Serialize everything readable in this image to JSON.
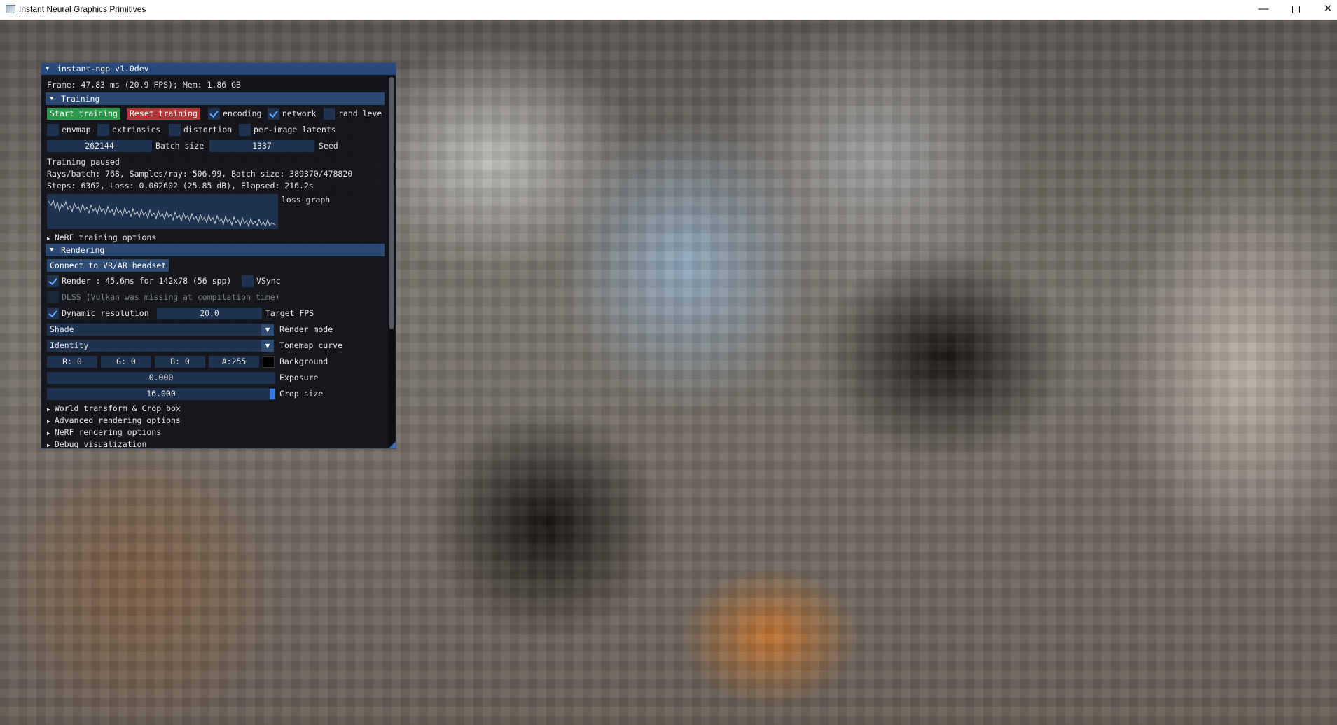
{
  "window": {
    "title": "Instant Neural Graphics Primitives",
    "minimize": "—",
    "close": "✕"
  },
  "panel": {
    "title": "instant-ngp v1.0dev",
    "frame_info": "Frame: 47.83 ms (20.9 FPS); Mem: 1.86 GB",
    "training": {
      "header": "Training",
      "start_label": "Start training",
      "reset_label": "Reset training",
      "encoding_label": "encoding",
      "network_label": "network",
      "rand_levels_label": "rand leve",
      "envmap_label": "envmap",
      "extrinsics_label": "extrinsics",
      "distortion_label": "distortion",
      "latents_label": "per-image latents",
      "batch_size_value": "262144",
      "batch_size_label": "Batch size",
      "seed_value": "1337",
      "seed_label": "Seed",
      "status": "Training paused",
      "rays_line": "Rays/batch: 768, Samples/ray: 506.99, Batch size: 389370/478820",
      "steps_line": "Steps: 6362, Loss: 0.002602 (25.85 dB), Elapsed: 216.2s",
      "loss_graph_label": "loss graph",
      "nerf_options": "NeRF training options"
    },
    "rendering": {
      "header": "Rendering",
      "vr_label": "Connect to VR/AR headset",
      "render_label": "Render : 45.6ms for 142x78 (56 spp)",
      "vsync_label": "VSync",
      "dlss_label": "DLSS (Vulkan was missing at compilation time)",
      "dynres_label": "Dynamic resolution",
      "target_fps_value": "20.0",
      "target_fps_label": "Target FPS",
      "render_mode_value": "Shade",
      "render_mode_label": "Render mode",
      "tonemap_value": "Identity",
      "tonemap_label": "Tonemap curve",
      "bg_r": "R:  0",
      "bg_g": "G:  0",
      "bg_b": "B:  0",
      "bg_a": "A:255",
      "background_label": "Background",
      "exposure_value": "0.000",
      "exposure_label": "Exposure",
      "crop_value": "16.000",
      "crop_label": "Crop size",
      "world_transform": "World transform & Crop box",
      "advanced": "Advanced rendering options",
      "nerf_render": "NeRF rendering options",
      "debug": "Debug visualization"
    }
  },
  "colors": {
    "title_bar": "#29497a",
    "header": "#2a4870",
    "start_button": "#2a9a4a",
    "reset_button": "#b03838",
    "checkmark": "#5fa8ff"
  }
}
